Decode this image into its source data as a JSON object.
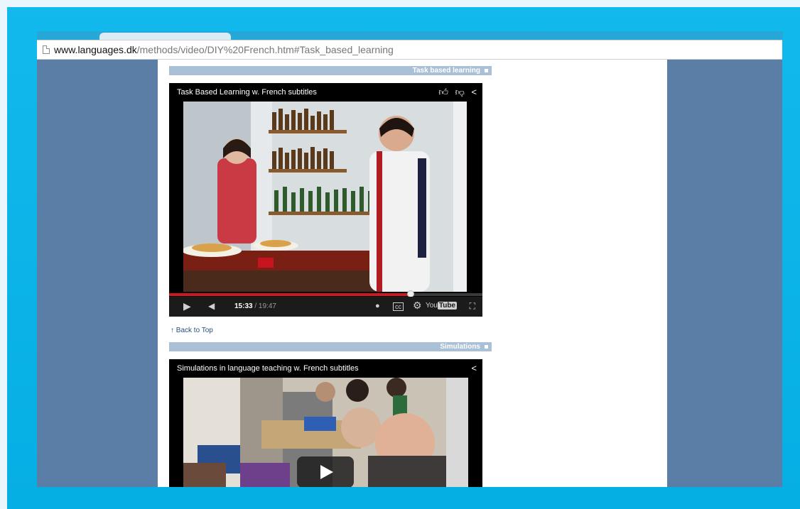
{
  "browser": {
    "url_domain": "www.languages.dk",
    "url_path": "/methods/video/DIY%20French.htm#Task_based_learning"
  },
  "sections": [
    {
      "heading": "Task based learning",
      "video_title": "Task Based Learning w. French subtitles",
      "time_current": "15:33",
      "time_total": " / 19:47",
      "progress": 0.77,
      "logo_text": "You",
      "logo_box": "Tube"
    },
    {
      "heading": "Simulations",
      "video_title": "Simulations in language teaching w. French subtitles"
    }
  ],
  "back_to_top": "Back to Top",
  "icons": {
    "like": "thumbs-up-icon",
    "dislike": "thumbs-down-icon",
    "share": "share-icon",
    "play": "play-icon",
    "volume": "volume-icon",
    "info": "info-icon",
    "cc": "captions-icon",
    "settings": "gear-icon",
    "fullscreen": "fullscreen-icon"
  },
  "colors": {
    "page_background": "#5b7ea6",
    "section_bar": "#a9c0d6",
    "progress": "#cc181e",
    "frame": "#0bb4e8"
  }
}
